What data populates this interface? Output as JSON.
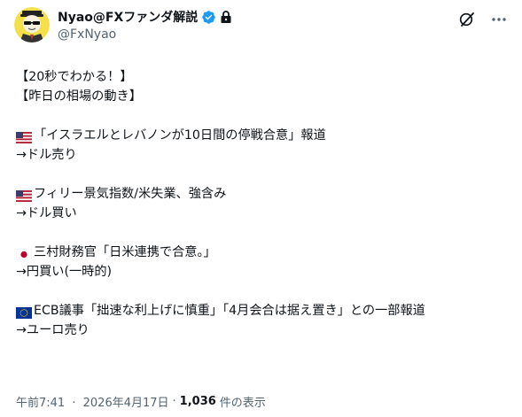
{
  "author": {
    "display_name": "Nyao@FXファンダ解説",
    "handle": "@FxNyao",
    "verified": true,
    "protected": true
  },
  "header_actions": {
    "grok_icon": "grok-icon",
    "more_icon": "more-icon"
  },
  "tweet": {
    "title_line1": "【20秒でわかる！】",
    "title_line2": "【昨日の相場の動き】",
    "items": [
      {
        "flag": "us-flag",
        "text": "「イスラエルとレバノンが10日間の停戦合意」報道",
        "result": "→ドル売り"
      },
      {
        "flag": "us-flag",
        "text": "フィリー景気指数/米失業、強含み",
        "result": "→ドル買い"
      },
      {
        "flag": "jp-flag",
        "text": "三村財務官「日米連携で合意。」",
        "result": "→円買い(一時的)"
      },
      {
        "flag": "eu-flag",
        "text": "ECB議事「拙速な利上げに慎重」「4月会合は据え置き」との一部報道",
        "result": "→ユーロ売り"
      }
    ]
  },
  "meta": {
    "time": "午前7:41",
    "separator": "·",
    "date": "2026年4月17日",
    "views_count": "1,036",
    "views_label": "件の表示"
  },
  "colors": {
    "text": "#0f1419",
    "secondary": "#536471",
    "verified_blue": "#1d9bf0"
  }
}
